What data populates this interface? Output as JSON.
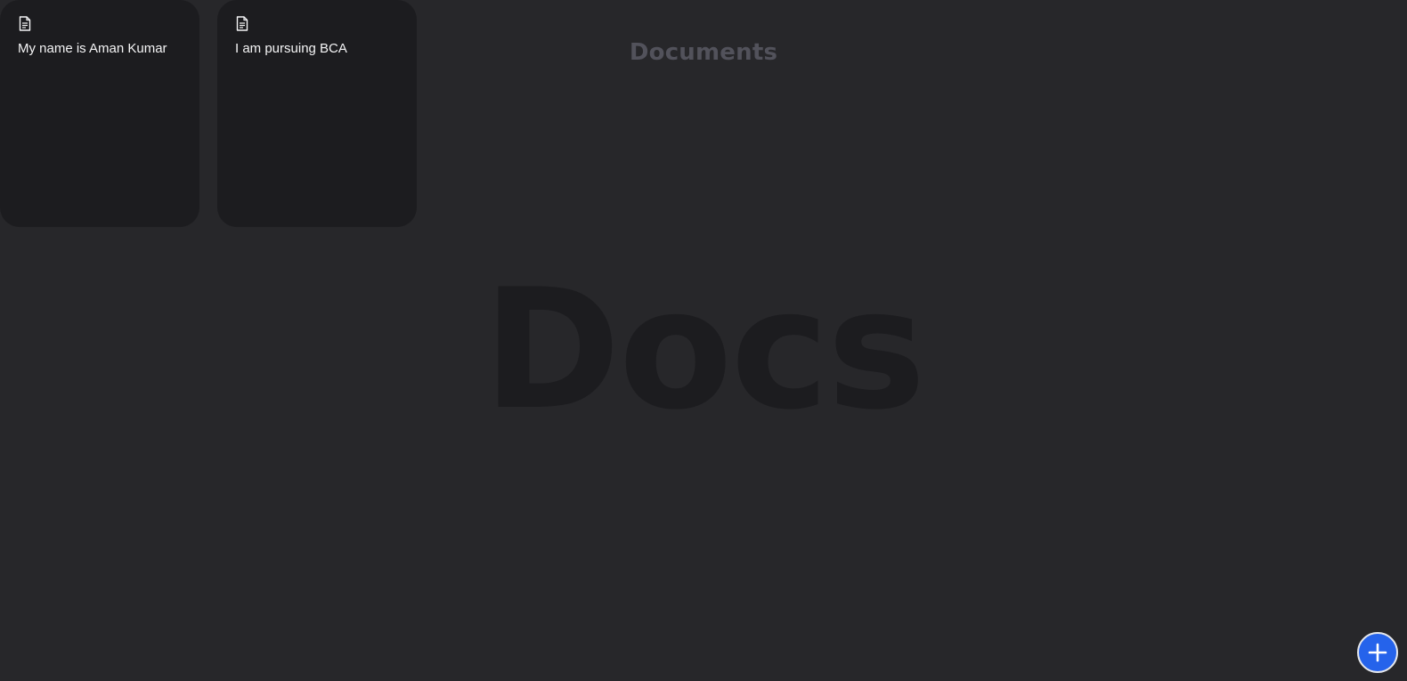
{
  "header": {
    "title": "Documents"
  },
  "background": {
    "watermark": "Docs"
  },
  "documents": [
    {
      "icon": "document-icon",
      "text": "My name is Aman Kumar"
    },
    {
      "icon": "document-icon",
      "text": "I am pursuing BCA"
    }
  ],
  "add_button": {
    "icon": "plus-icon",
    "color": "#2563eb"
  },
  "colors": {
    "background": "#27272a",
    "card": "#1c1c1f",
    "heading": "#52525b",
    "watermark": "#1c1c1f",
    "card_text": "#f4f4f5"
  }
}
